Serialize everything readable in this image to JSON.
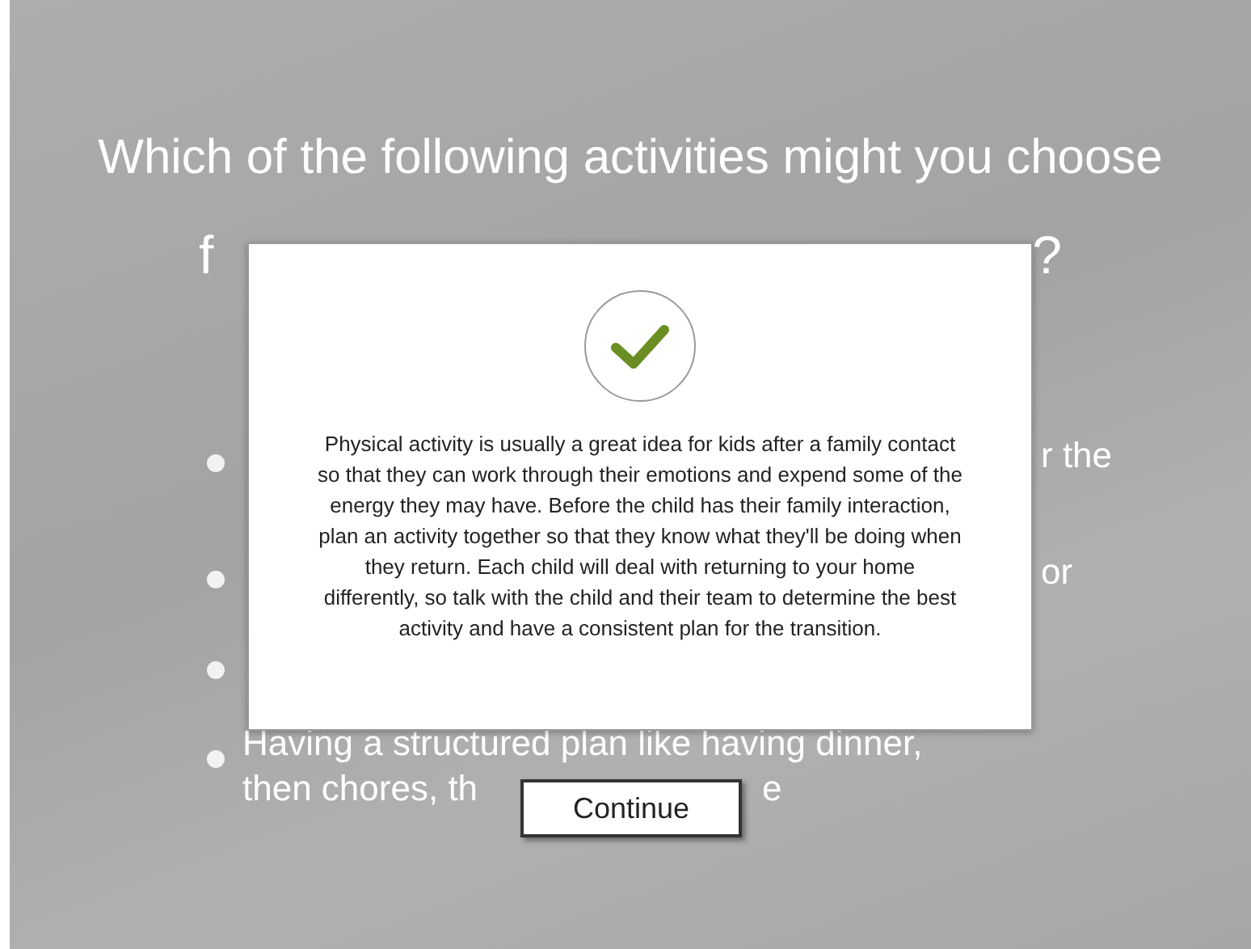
{
  "question": {
    "line_1": "Which of the following activities might you choose",
    "line_2_start": "f",
    "line_2_end": "?"
  },
  "options": [
    {
      "kind": "covered_tail",
      "tail": "r the"
    },
    {
      "kind": "covered_tail",
      "tail": "or"
    },
    {
      "kind": "covered"
    },
    {
      "kind": "split",
      "line_1": "Having a structured plan like having dinner,",
      "line_2_start": "then chores, th",
      "line_2_end": "e"
    }
  ],
  "feedback": {
    "correct": true,
    "text": "Physical activity is usually a great idea for kids after a family contact so that they can work through their emotions and expend some of the energy they may have. Before the child has their family interaction, plan an activity together so that they know what they'll be doing when they return. Each child will deal with returning to your home differently, so talk with the child and their team to determine the best activity and have a consistent plan for the transition.",
    "button": "Continue"
  }
}
